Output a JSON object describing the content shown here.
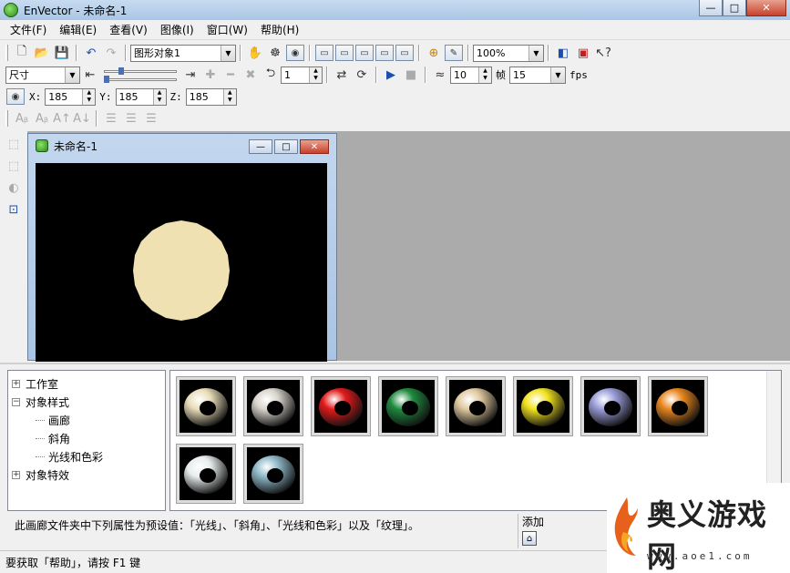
{
  "window": {
    "title": "EnVector - 未命名-1",
    "controls": [
      "—",
      "□",
      "✕"
    ]
  },
  "menu": [
    "文件(F)",
    "编辑(E)",
    "查看(V)",
    "图像(I)",
    "窗口(W)",
    "帮助(H)"
  ],
  "toolbar1": {
    "object_combo": "图形对象1",
    "zoom_combo": "100%"
  },
  "toolbar2": {
    "size_combo": "尺寸",
    "frame_value": "1",
    "step_value": "10",
    "frames_label": "帧",
    "fps_value": "15",
    "fps_label": "fps"
  },
  "toolbar3": {
    "x_label": "X:",
    "x_value": "185",
    "y_label": "Y:",
    "y_value": "185",
    "z_label": "Z:",
    "z_value": "185"
  },
  "child_window": {
    "title": "未命名-1",
    "shape_color": "#f0e1b2",
    "canvas_color": "#000000"
  },
  "tree": {
    "items": [
      {
        "label": "工作室",
        "expander": "+",
        "level": 0
      },
      {
        "label": "对象样式",
        "expander": "−",
        "level": 0
      },
      {
        "label": "画廊",
        "level": 1
      },
      {
        "label": "斜角",
        "level": 1
      },
      {
        "label": "光线和色彩",
        "level": 1
      },
      {
        "label": "对象特效",
        "expander": "+",
        "level": 0
      }
    ]
  },
  "gallery": {
    "colors": [
      "#e8dcb8",
      "#d8d4cc",
      "#e21a1a",
      "#1f8a3e",
      "#e0c9a0",
      "#f2e21e",
      "#9a9cd8",
      "#e8861e",
      "#e6ecec",
      "#8fb8c8"
    ]
  },
  "description": "此画廊文件夹中下列属性为预设值：「光线」、「斜角」、「光线和色彩」以及「纹理」。",
  "add_label": "添加",
  "status_text": "要获取「帮助」，请按 F1 键",
  "watermark": {
    "text": "奥义游戏网",
    "url": "www.aoe1.com"
  }
}
